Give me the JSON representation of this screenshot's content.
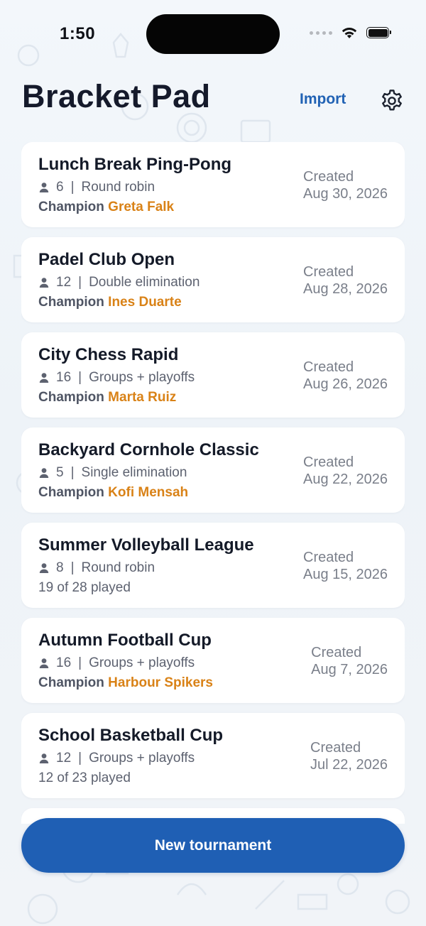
{
  "status_bar": {
    "time": "1:50"
  },
  "header": {
    "title": "Bracket Pad",
    "import_label": "Import"
  },
  "tournaments": [
    {
      "name": "Lunch Break Ping-Pong",
      "players": "6",
      "format": "Round robin",
      "champion_label": "Champion",
      "champion": "Greta Falk",
      "progress": "",
      "created_label": "Created",
      "created": "Aug 30, 2026"
    },
    {
      "name": "Padel Club Open",
      "players": "12",
      "format": "Double elimination",
      "champion_label": "Champion",
      "champion": "Ines Duarte",
      "progress": "",
      "created_label": "Created",
      "created": "Aug 28, 2026"
    },
    {
      "name": "City Chess Rapid",
      "players": "16",
      "format": "Groups + playoffs",
      "champion_label": "Champion",
      "champion": "Marta Ruiz",
      "progress": "",
      "created_label": "Created",
      "created": "Aug 26, 2026"
    },
    {
      "name": "Backyard Cornhole Classic",
      "players": "5",
      "format": "Single elimination",
      "champion_label": "Champion",
      "champion": "Kofi Mensah",
      "progress": "",
      "created_label": "Created",
      "created": "Aug 22, 2026"
    },
    {
      "name": "Summer Volleyball League",
      "players": "8",
      "format": "Round robin",
      "champion_label": "",
      "champion": "",
      "progress": "19 of 28 played",
      "created_label": "Created",
      "created": "Aug 15, 2026"
    },
    {
      "name": "Autumn Football Cup",
      "players": "16",
      "format": "Groups + playoffs",
      "champion_label": "Champion",
      "champion": "Harbour Spikers",
      "progress": "",
      "created_label": "Created",
      "created": "Aug 7, 2026"
    },
    {
      "name": "School Basketball Cup",
      "players": "12",
      "format": "Groups + playoffs",
      "champion_label": "",
      "champion": "",
      "progress": "12 of 23 played",
      "created_label": "Created",
      "created": "Jul 22, 2026"
    }
  ],
  "footer": {
    "new_button_label": "New tournament"
  },
  "colors": {
    "accent": "#1f5fb4",
    "champion": "#d98217",
    "title": "#151a2b"
  },
  "icons": {
    "settings": "gear-icon",
    "players": "person-icon",
    "wifi": "wifi-icon",
    "battery": "battery-icon"
  }
}
